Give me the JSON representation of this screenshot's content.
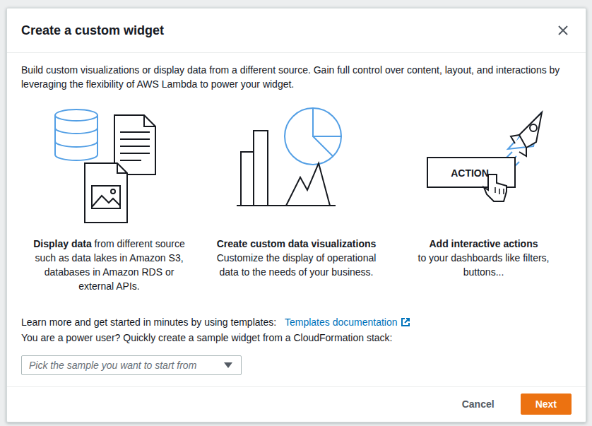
{
  "dialog": {
    "title": "Create a custom widget",
    "description": "Build custom visualizations or display data from a different source. Gain full control over content, layout, and interactions by leveraging the flexibility of AWS Lambda to power your widget."
  },
  "features": [
    {
      "kind": "inline",
      "title": "Display data",
      "text": "from different source such as data lakes in Amazon S3, databases in Amazon RDS or external APIs."
    },
    {
      "kind": "stacked",
      "title": "Create custom data visualizations",
      "text": "Customize the display of operational data to the needs of your business."
    },
    {
      "kind": "stacked",
      "title": "Add interactive actions",
      "text": "to your dashboards like filters, buttons...",
      "badge": "ACTION"
    }
  ],
  "templates": {
    "label": "Learn more and get started in minutes by using templates:",
    "link": "Templates documentation"
  },
  "power_user": "You are a power user? Quickly create a sample widget from a CloudFormation stack:",
  "sample_select": {
    "placeholder": "Pick the sample you want to start from"
  },
  "buttons": [
    {
      "label": "Cancel",
      "kind": "link"
    },
    {
      "label": "Next",
      "kind": "primary"
    }
  ]
}
